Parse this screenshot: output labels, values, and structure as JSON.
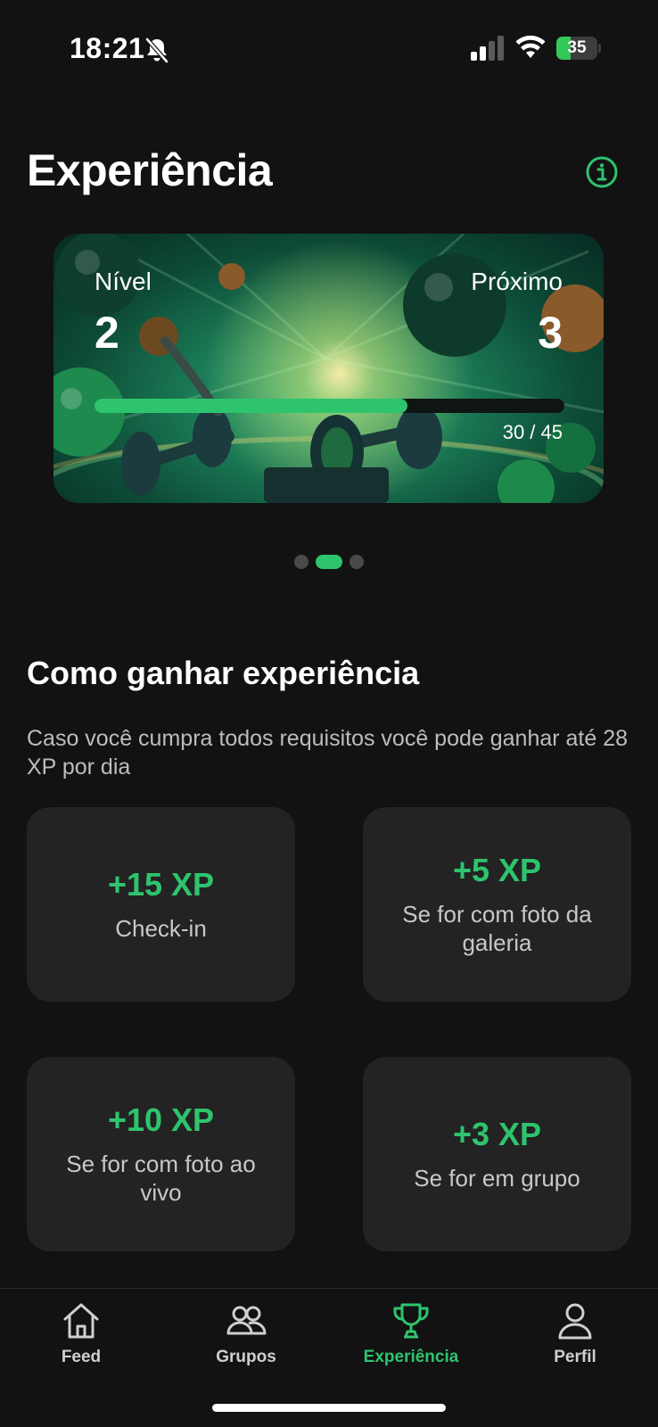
{
  "status_bar": {
    "time": "18:21",
    "battery_level": 35,
    "battery_label": "35",
    "icons": [
      "bell-slash-icon",
      "cellular-signal-icon",
      "wifi-icon",
      "battery-charging-icon"
    ]
  },
  "header": {
    "title": "Experiência",
    "info_icon": "info-circle-icon"
  },
  "level_card": {
    "current_label": "Nível",
    "current_level": "2",
    "next_label": "Próximo",
    "next_level": "3",
    "xp_current": 30,
    "xp_total": 45,
    "progress_text": "30 / 45"
  },
  "pager": {
    "count": 3,
    "active_index": 1
  },
  "earn_section": {
    "title": "Como ganhar experiência",
    "description": "Caso você cumpra todos requisitos você pode ganhar até 28 XP por dia",
    "cards": [
      {
        "xp": "+15 XP",
        "label": "Check-in"
      },
      {
        "xp": "+5 XP",
        "label": "Se for com foto da galeria"
      },
      {
        "xp": "+10 XP",
        "label": "Se for com foto ao vivo"
      },
      {
        "xp": "+3 XP",
        "label": "Se for em grupo"
      }
    ]
  },
  "bottom_nav": {
    "items": [
      {
        "label": "Feed",
        "icon": "home-icon",
        "active": false
      },
      {
        "label": "Grupos",
        "icon": "users-icon",
        "active": false
      },
      {
        "label": "Experiência",
        "icon": "trophy-icon",
        "active": true
      },
      {
        "label": "Perfil",
        "icon": "user-icon",
        "active": false
      }
    ]
  },
  "colors": {
    "background": "#121212",
    "accent": "#2ec46e",
    "card": "#232323",
    "text_muted": "#bdbdbd"
  }
}
